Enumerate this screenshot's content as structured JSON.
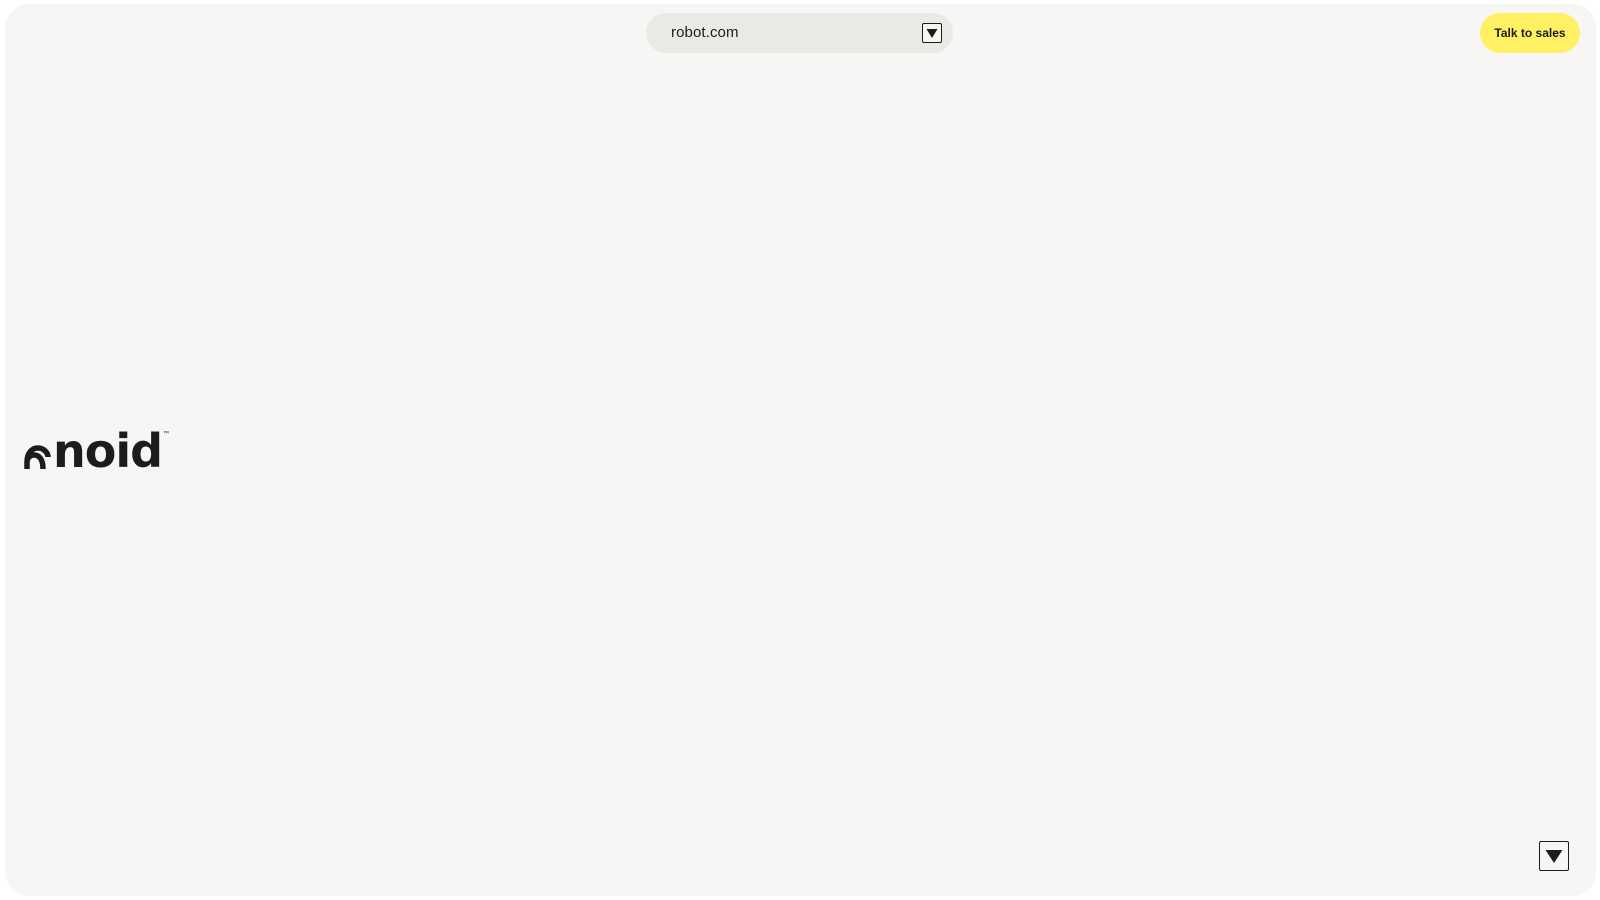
{
  "header": {
    "url": "robot.com",
    "url_toggle_icon": "triangle-down-icon",
    "cta_label": "Talk to sales",
    "cta_color": "#fff064"
  },
  "hero": {
    "logo_text": "noid",
    "logo_tm": "™"
  },
  "footer": {
    "scroll_icon": "triangle-down-icon"
  },
  "colors": {
    "background": "#f7f6f4",
    "url_bar": "#eae9e6",
    "text": "#1c1c1c"
  }
}
